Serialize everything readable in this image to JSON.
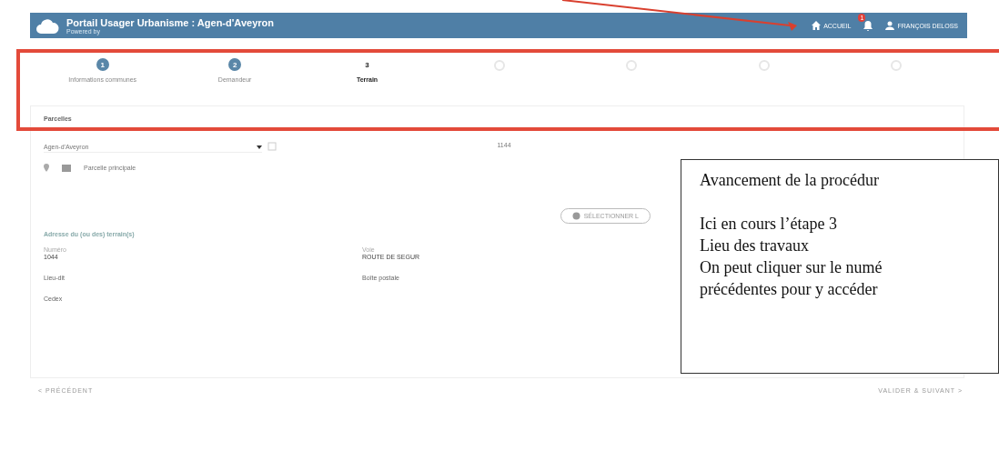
{
  "header": {
    "title": "Portail Usager Urbanisme : Agen-d'Aveyron",
    "subtitle": "Powered by",
    "home_link": "ACCUEIL",
    "notification_count": "1",
    "user": "FRANÇOIS DELOSS"
  },
  "steps": [
    {
      "number": "1",
      "label": "Informations communes",
      "kind": "numbered",
      "selected": false
    },
    {
      "number": "2",
      "label": "Demandeur",
      "kind": "numbered",
      "selected": false
    },
    {
      "number": "3",
      "label": "Terrain",
      "kind": "numbered",
      "selected": true
    },
    {
      "kind": "pending"
    },
    {
      "kind": "pending"
    },
    {
      "kind": "pending"
    },
    {
      "kind": "pending"
    }
  ],
  "parcels": {
    "title": "Parcelles",
    "commune": "Agen-d'Aveyron",
    "parcel_number": "1144",
    "main_parcel_label": "Parcelle principale",
    "select_button": "SÉLECTIONNER L"
  },
  "address": {
    "title": "Adresse du (ou des) terrain(s)",
    "fields": [
      {
        "label": "Numéro",
        "value": "1044"
      },
      {
        "label": "Voie",
        "value": "ROUTE DE SEGUR"
      },
      {
        "label": "Lieu-dit"
      },
      {
        "label": "Boîte postale"
      },
      {
        "label": "Cedex"
      }
    ]
  },
  "footer": {
    "previous": "< PRÉCÉDENT",
    "next": "VALIDER & SUIVANT >"
  },
  "annotation": {
    "title": "Avancement de la procédur",
    "lines": [
      "Ici en cours l’étape 3",
      "Lieu des travaux",
      "On peut cliquer sur le numé",
      "précédentes pour y accéder"
    ]
  }
}
